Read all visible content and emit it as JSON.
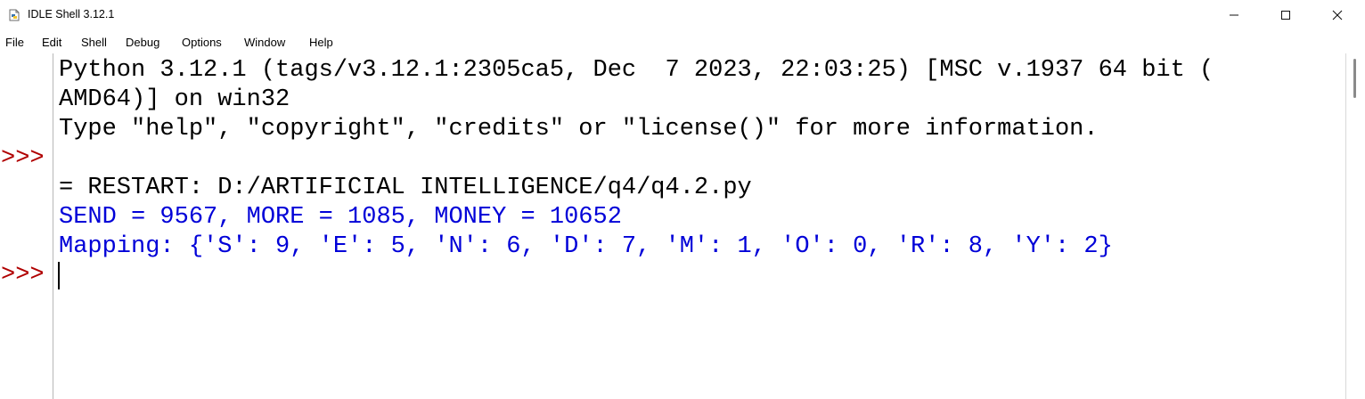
{
  "window": {
    "title": "IDLE Shell 3.12.1",
    "icon": "python-feather-icon",
    "controls": {
      "minimize": "─",
      "maximize": "☐",
      "close": "✕"
    }
  },
  "menubar": {
    "items": [
      "File",
      "Edit",
      "Shell",
      "Debug",
      "Options",
      "Window",
      "Help"
    ]
  },
  "shell": {
    "prompt": ">>>",
    "lines": [
      "Python 3.12.1 (tags/v3.12.1:2305ca5, Dec  7 2023, 22:03:25) [MSC v.1937 64 bit (",
      "AMD64)] on win32",
      "Type \"help\", \"copyright\", \"credits\" or \"license()\" for more information.",
      "= RESTART: D:/ARTIFICIAL INTELLIGENCE/q4/q4.2.py",
      "SEND = 9567, MORE = 1085, MONEY = 10652",
      "Mapping: {'S': 9, 'E': 5, 'N': 6, 'D': 7, 'M': 1, 'O': 0, 'R': 8, 'Y': 2}"
    ]
  },
  "colors": {
    "prompt": "#b00000",
    "stdout": "#0000d8",
    "text": "#000000"
  }
}
